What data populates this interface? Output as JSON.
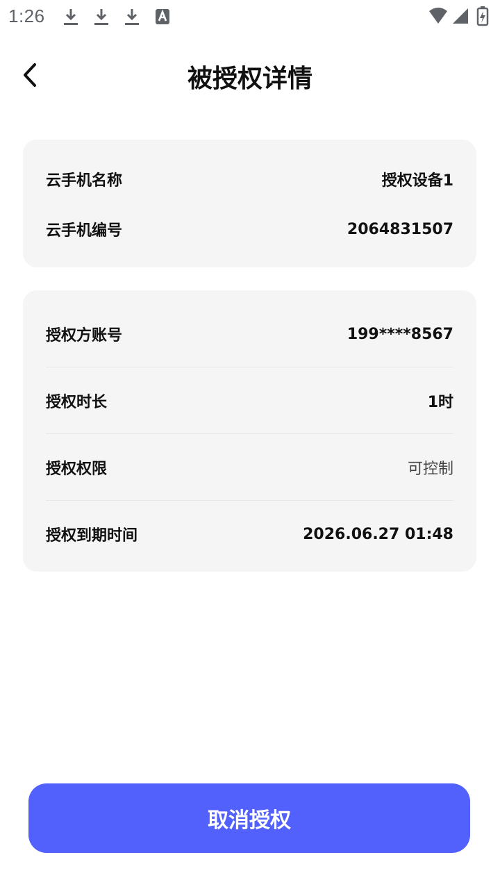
{
  "status_bar": {
    "time": "1:26",
    "icons": [
      "download-icon",
      "download-icon",
      "download-icon",
      "text-a-icon",
      "wifi-icon",
      "signal-icon",
      "battery-charging-icon"
    ]
  },
  "header": {
    "title": "被授权详情",
    "back_icon": "chevron-left-icon"
  },
  "device_card": {
    "rows": [
      {
        "label": "云手机名称",
        "value": "授权设备1"
      },
      {
        "label": "云手机编号",
        "value": "2064831507"
      }
    ]
  },
  "auth_card": {
    "rows": [
      {
        "label": "授权方账号",
        "value": "199****8567"
      },
      {
        "label": "授权时长",
        "value": "1时"
      },
      {
        "label": "授权权限",
        "value": "可控制"
      },
      {
        "label": "授权到期时间",
        "value": "2026.06.27 01:48"
      }
    ]
  },
  "actions": {
    "cancel_label": "取消授权"
  },
  "colors": {
    "accent": "#5260fc",
    "card_bg": "#f5f5f5",
    "text": "#111111"
  }
}
